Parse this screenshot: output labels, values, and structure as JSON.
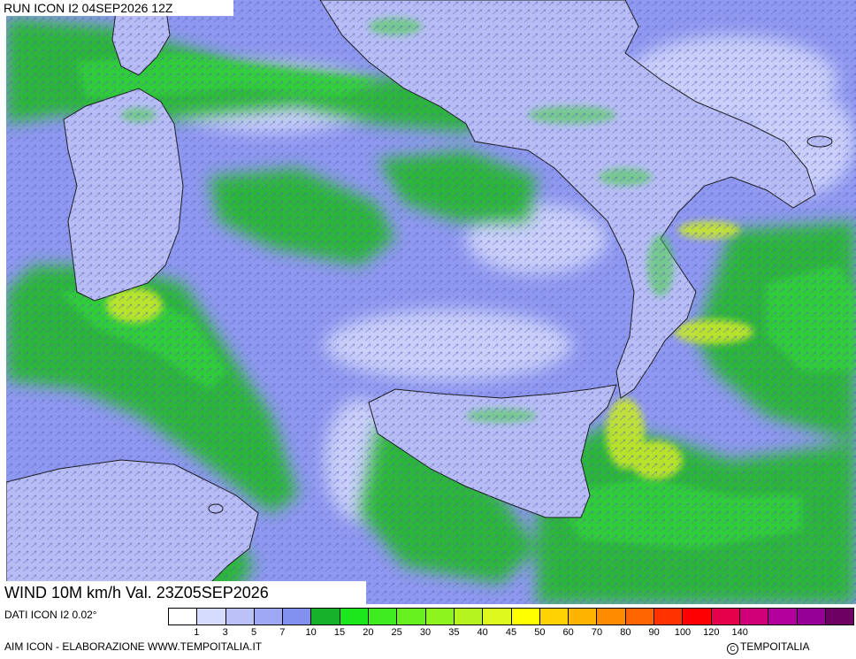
{
  "header": {
    "run_label": "RUN ICON I2 04SEP2026 12Z"
  },
  "map": {
    "field_label": "WIND 10M km/h Val. 23Z05SEP2026",
    "region": "Southern Italy, Sardinia, Sicily, Tunisia coast",
    "base_color": "#8f98f0",
    "land_border_color": "#1a1a1a"
  },
  "footer": {
    "dati": "DATI ICON I2 0.02°",
    "elaborazione": "AIM ICON - ELABORAZIONE WWW.TEMPOITALIA.IT",
    "copyright_text": "TEMPOITALIA",
    "copyright_icon": "copyright-icon"
  },
  "legend": {
    "unit": "km/h",
    "colors": [
      "#ffffff",
      "#d6dcfb",
      "#bac2f7",
      "#9ea8f4",
      "#8290f0",
      "#16b02a",
      "#1ce61c",
      "#3fec1f",
      "#66f01e",
      "#8ef41e",
      "#b5f41e",
      "#dcf81c",
      "#ffff00",
      "#ffd200",
      "#ffb400",
      "#ff8c00",
      "#ff6400",
      "#ff3200",
      "#ff0000",
      "#e6004b",
      "#d20078",
      "#b4009b",
      "#960096",
      "#6e0064"
    ],
    "ticks": [
      "1",
      "3",
      "5",
      "7",
      "10",
      "15",
      "20",
      "25",
      "30",
      "35",
      "40",
      "45",
      "50",
      "60",
      "70",
      "80",
      "90",
      "100",
      "120",
      "140"
    ]
  }
}
